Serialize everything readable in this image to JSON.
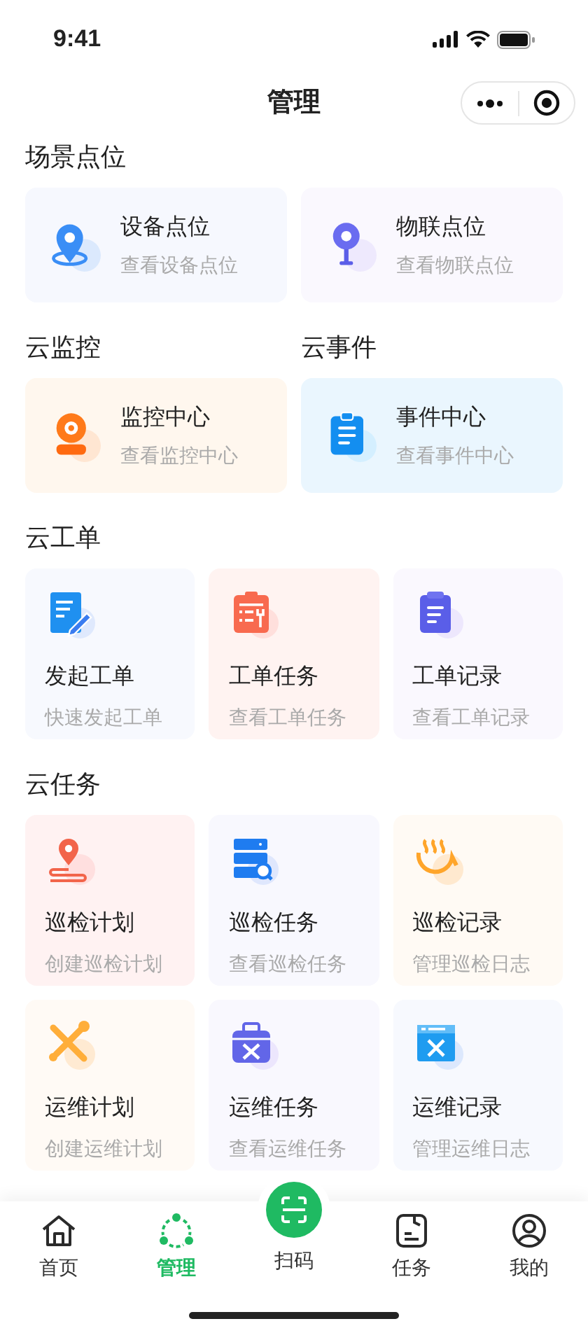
{
  "status_bar": {
    "time": "9:41"
  },
  "nav": {
    "title": "管理"
  },
  "sections": [
    {
      "title": "场景点位",
      "kind": "pair",
      "items": [
        {
          "title": "设备点位",
          "subtitle": "查看设备点位"
        },
        {
          "title": "物联点位",
          "subtitle": "查看物联点位"
        }
      ]
    },
    {
      "title": "云监控",
      "kind": "half",
      "items": [
        {
          "title": "监控中心",
          "subtitle": "查看监控中心"
        }
      ]
    },
    {
      "title": "云事件",
      "kind": "half",
      "items": [
        {
          "title": "事件中心",
          "subtitle": "查看事件中心"
        }
      ]
    },
    {
      "title": "云工单",
      "kind": "grid",
      "items": [
        {
          "title": "发起工单",
          "subtitle": "快速发起工单"
        },
        {
          "title": "工单任务",
          "subtitle": "查看工单任务"
        },
        {
          "title": "工单记录",
          "subtitle": "查看工单记录"
        }
      ]
    },
    {
      "title": "云任务",
      "kind": "grid",
      "items": [
        {
          "title": "巡检计划",
          "subtitle": "创建巡检计划"
        },
        {
          "title": "巡检任务",
          "subtitle": "查看巡检任务"
        },
        {
          "title": "巡检记录",
          "subtitle": "管理巡检日志"
        },
        {
          "title": "运维计划",
          "subtitle": "创建运维计划"
        },
        {
          "title": "运维任务",
          "subtitle": "查看运维任务"
        },
        {
          "title": "运维记录",
          "subtitle": "管理运维日志"
        }
      ]
    }
  ],
  "tab_bar": [
    {
      "label": "首页",
      "kind": "normal",
      "selected": false
    },
    {
      "label": "管理",
      "kind": "normal",
      "selected": true
    },
    {
      "label": "扫码",
      "kind": "scan",
      "selected": false
    },
    {
      "label": "任务",
      "kind": "normal",
      "selected": false
    },
    {
      "label": "我的",
      "kind": "normal",
      "selected": false
    }
  ]
}
